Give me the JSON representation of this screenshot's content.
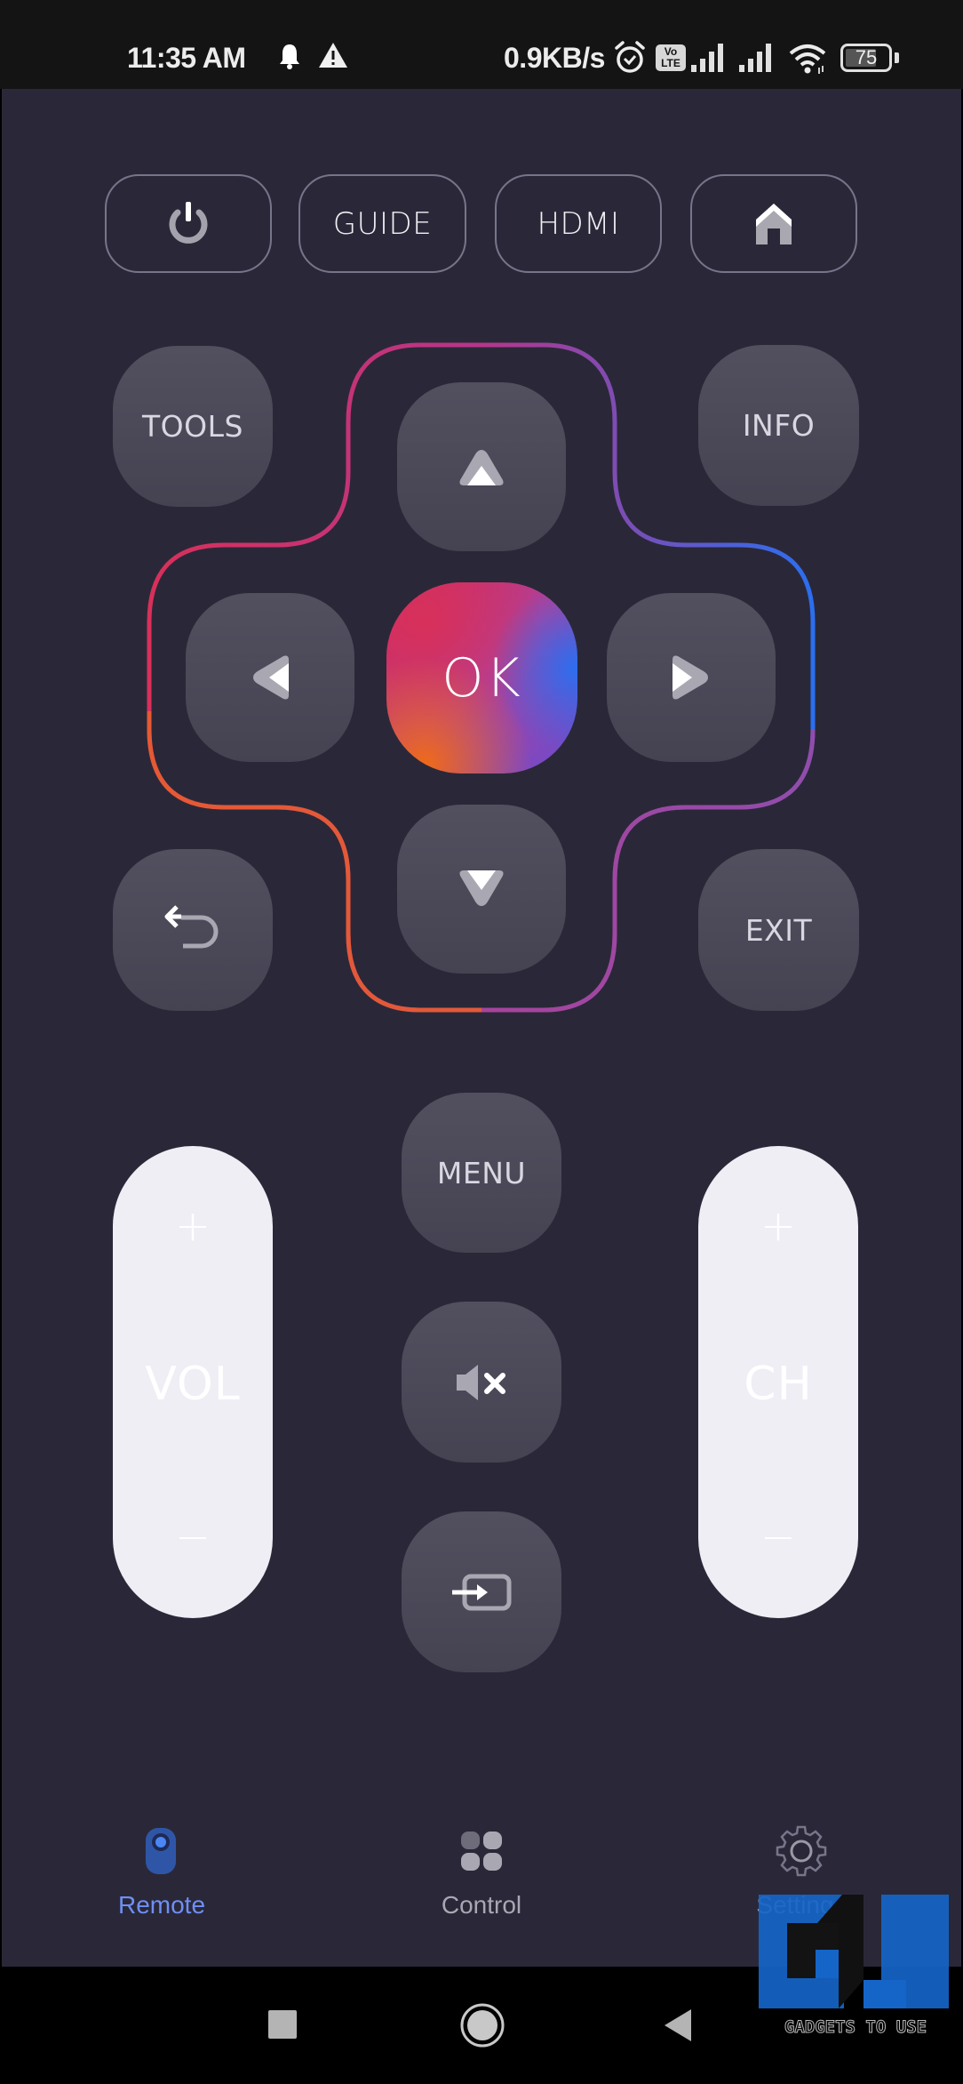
{
  "status_bar": {
    "time": "11:35 AM",
    "network_speed": "0.9KB/s",
    "battery_level": "75",
    "icons": [
      "notification-bell-icon",
      "warning-icon",
      "alarm-icon",
      "volte-icon",
      "signal-icon",
      "signal-icon",
      "wifi-icon",
      "battery-icon"
    ],
    "volte_top": "Vo",
    "volte_bottom": "LTE"
  },
  "top_row": {
    "power": {
      "icon": "power-icon"
    },
    "guide": {
      "label": "GUIDE"
    },
    "hdmi": {
      "label": "HDMI"
    },
    "home": {
      "icon": "home-icon"
    }
  },
  "side_buttons": {
    "tools": "TOOLS",
    "info": "INFO",
    "back": {
      "icon": "back-arrow-icon"
    },
    "exit": "EXIT"
  },
  "dpad": {
    "ok_label": "OK",
    "up": {
      "icon": "triangle-up-icon"
    },
    "down": {
      "icon": "triangle-down-icon"
    },
    "left": {
      "icon": "triangle-left-icon"
    },
    "right": {
      "icon": "triangle-right-icon"
    },
    "outline_colors": {
      "left": "#d8305a",
      "bottom_left": "#ef6a2a",
      "right": "#2b6ef0",
      "bottom_right": "#b0459a"
    }
  },
  "volume": {
    "label": "VOL",
    "plus": "+",
    "minus": "−"
  },
  "channel": {
    "label": "CH",
    "plus": "+",
    "minus": "−"
  },
  "center_column": {
    "menu": "MENU",
    "mute": {
      "icon": "mute-icon"
    },
    "input": {
      "icon": "input-source-icon"
    }
  },
  "tab_bar": {
    "active_color": "#6f8ff5",
    "inactive_color": "#a9a7b4",
    "tabs": [
      {
        "label": "Remote",
        "icon": "remote-icon",
        "active": true
      },
      {
        "label": "Control",
        "icon": "grid-icon",
        "active": false
      },
      {
        "label": "Settings",
        "icon": "gear-icon",
        "active": false
      }
    ]
  },
  "nav_bar": {
    "buttons": [
      "recents-square-icon",
      "home-circle-icon",
      "back-triangle-icon"
    ]
  },
  "watermark": {
    "text": "GADGETS TO USE"
  },
  "colors": {
    "background": "#2a2838",
    "button": "#4c4a5a",
    "pill": "#efeef5",
    "status_bar": "#141414"
  }
}
